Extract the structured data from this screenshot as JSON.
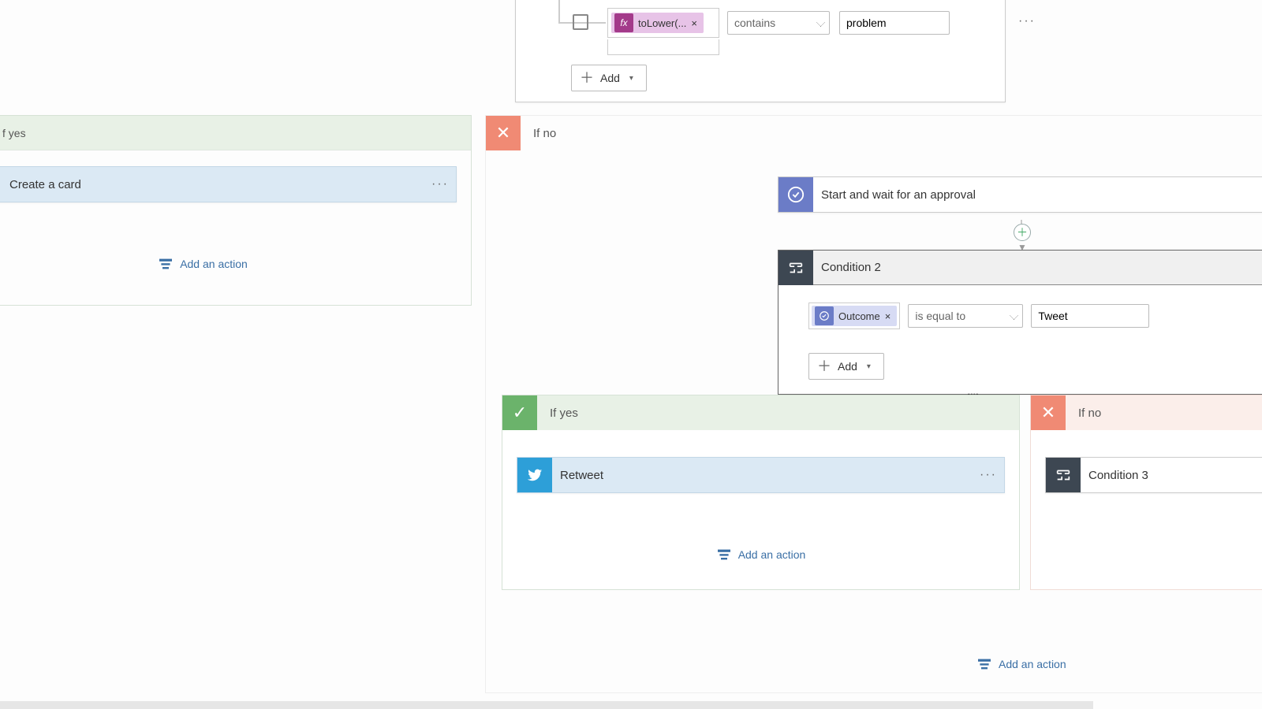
{
  "top_condition": {
    "token": {
      "label": "toLower(...",
      "icon": "fx"
    },
    "operator": "contains",
    "value": "problem",
    "add_label": "Add"
  },
  "branch1": {
    "yes": {
      "title": "f yes",
      "action1": {
        "title": "Create a card"
      },
      "add_action": "Add an action"
    },
    "no": {
      "title": "If no"
    }
  },
  "approval": {
    "title": "Start and wait for an approval"
  },
  "condition2": {
    "title": "Condition 2",
    "token": {
      "label": "Outcome"
    },
    "operator": "is equal to",
    "value": "Tweet",
    "add_label": "Add"
  },
  "branch2": {
    "yes": {
      "title": "If yes",
      "action_retweet": {
        "title": "Retweet"
      },
      "add_action": "Add an action"
    },
    "no": {
      "title": "If no",
      "action_condition3": {
        "title": "Condition 3"
      }
    }
  },
  "footer": {
    "add_action": "Add an action"
  }
}
